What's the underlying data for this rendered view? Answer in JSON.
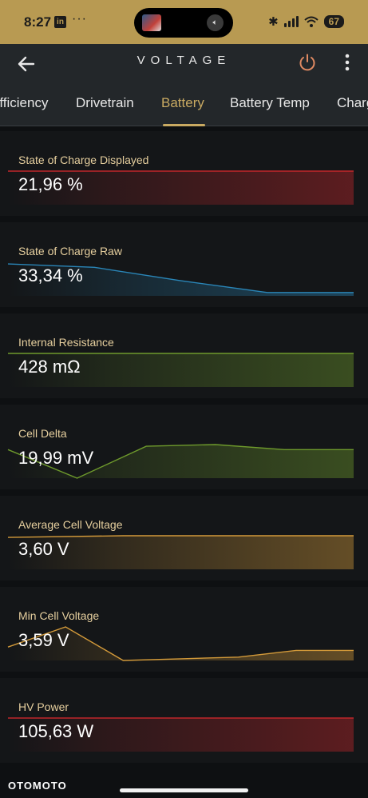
{
  "status_bar": {
    "time": "8:27",
    "linkedin": "in",
    "dots": "···",
    "island_thumb_text": "AC AION",
    "battery": "67",
    "icons": [
      "linkedin-icon",
      "more-dots-icon",
      "mute-icon",
      "bluetooth-icon",
      "signal-icon",
      "wifi-icon",
      "battery-icon"
    ]
  },
  "header": {
    "title": "VOLTAGE",
    "icons": [
      "back-arrow-icon",
      "power-icon",
      "more-vertical-icon"
    ]
  },
  "tabs": [
    {
      "label": "Efficiency"
    },
    {
      "label": "Drivetrain"
    },
    {
      "label": "Battery",
      "active": true
    },
    {
      "label": "Battery Temp"
    },
    {
      "label": "Charging"
    }
  ],
  "colors": {
    "accent": "#c9aa62",
    "status_bar": "#b89a52",
    "red": "#c0262a",
    "blue": "#2a86b8",
    "green": "#6e9a2c",
    "orange": "#d39a3a"
  },
  "cards": [
    {
      "label": "State of Charge Displayed",
      "value": "21,96 %",
      "color": "red",
      "trend": [
        1,
        1,
        1,
        1
      ]
    },
    {
      "label": "State of Charge Raw",
      "value": "33,34 %",
      "color": "blue",
      "trend": [
        0.95,
        0.85,
        0.45,
        0.1,
        0.1
      ]
    },
    {
      "label": "Internal Resistance",
      "value": "428 mΩ",
      "color": "green",
      "trend": [
        1,
        1,
        1,
        1
      ]
    },
    {
      "label": "Cell Delta",
      "value": "19,99 mV",
      "color": "green",
      "trend": [
        0.85,
        0.0,
        0.95,
        1.0,
        0.85,
        0.85
      ]
    },
    {
      "label": "Average Cell Voltage",
      "value": "3,60 V",
      "color": "orange",
      "trend": [
        0.95,
        1,
        1,
        1
      ]
    },
    {
      "label": "Min Cell Voltage",
      "value": "3,59 V",
      "color": "orange",
      "trend": [
        0.4,
        1.0,
        0.0,
        0.05,
        0.1,
        0.3,
        0.3
      ]
    },
    {
      "label": "HV Power",
      "value": "105,63 W",
      "color": "red",
      "trend": [
        1,
        1,
        1,
        1
      ]
    }
  ],
  "watermark": "OTOMOTO"
}
